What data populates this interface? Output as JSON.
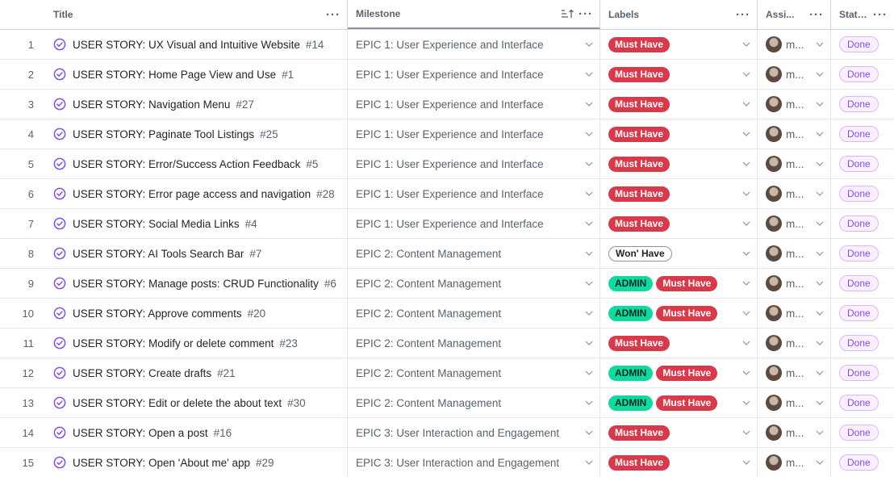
{
  "columns": {
    "title": "Title",
    "milestone": "Milestone",
    "labels": "Labels",
    "assignees": "Assi...",
    "status": "Status"
  },
  "colors": {
    "must_have": "#d73a4a",
    "admin": "#10d9a0",
    "status_done": "#8250df",
    "issue_icon": "#8250df"
  },
  "rows": [
    {
      "num": "1",
      "title": "USER STORY: UX Visual and Intuitive Website",
      "issue": "#14",
      "milestone": "EPIC 1: User Experience and Interface",
      "labels": [
        "Must Have"
      ],
      "assignee": "m...",
      "status": "Done"
    },
    {
      "num": "2",
      "title": "USER STORY: Home Page View and Use",
      "issue": "#1",
      "milestone": "EPIC 1: User Experience and Interface",
      "labels": [
        "Must Have"
      ],
      "assignee": "m...",
      "status": "Done"
    },
    {
      "num": "3",
      "title": "USER STORY: Navigation Menu",
      "issue": "#27",
      "milestone": "EPIC 1: User Experience and Interface",
      "labels": [
        "Must Have"
      ],
      "assignee": "m...",
      "status": "Done"
    },
    {
      "num": "4",
      "title": "USER STORY: Paginate Tool Listings",
      "issue": "#25",
      "milestone": "EPIC 1: User Experience and Interface",
      "labels": [
        "Must Have"
      ],
      "assignee": "m...",
      "status": "Done"
    },
    {
      "num": "5",
      "title": "USER STORY: Error/Success Action Feedback",
      "issue": "#5",
      "milestone": "EPIC 1: User Experience and Interface",
      "labels": [
        "Must Have"
      ],
      "assignee": "m...",
      "status": "Done"
    },
    {
      "num": "6",
      "title": "USER STORY: Error page access and navigation",
      "issue": "#28",
      "milestone": "EPIC 1: User Experience and Interface",
      "labels": [
        "Must Have"
      ],
      "assignee": "m...",
      "status": "Done"
    },
    {
      "num": "7",
      "title": "USER STORY: Social Media Links",
      "issue": "#4",
      "milestone": "EPIC 1: User Experience and Interface",
      "labels": [
        "Must Have"
      ],
      "assignee": "m...",
      "status": "Done"
    },
    {
      "num": "8",
      "title": "USER STORY: AI Tools Search Bar",
      "issue": "#7",
      "milestone": "EPIC 2: Content Management",
      "labels": [
        "Won' Have"
      ],
      "assignee": "m...",
      "status": "Done"
    },
    {
      "num": "9",
      "title": "USER STORY: Manage posts: CRUD Functionality",
      "issue": "#6",
      "milestone": "EPIC 2: Content Management",
      "labels": [
        "ADMIN",
        "Must Have"
      ],
      "assignee": "m...",
      "status": "Done"
    },
    {
      "num": "10",
      "title": "USER STORY: Approve comments",
      "issue": "#20",
      "milestone": "EPIC 2: Content Management",
      "labels": [
        "ADMIN",
        "Must Have"
      ],
      "assignee": "m...",
      "status": "Done"
    },
    {
      "num": "11",
      "title": "USER STORY: Modify or delete comment",
      "issue": "#23",
      "milestone": "EPIC 2: Content Management",
      "labels": [
        "Must Have"
      ],
      "assignee": "m...",
      "status": "Done"
    },
    {
      "num": "12",
      "title": "USER STORY: Create drafts",
      "issue": "#21",
      "milestone": "EPIC 2: Content Management",
      "labels": [
        "ADMIN",
        "Must Have"
      ],
      "assignee": "m...",
      "status": "Done"
    },
    {
      "num": "13",
      "title": "USER STORY: Edit or delete the about text",
      "issue": "#30",
      "milestone": "EPIC 2: Content Management",
      "labels": [
        "ADMIN",
        "Must Have"
      ],
      "assignee": "m...",
      "status": "Done"
    },
    {
      "num": "14",
      "title": "USER STORY: Open a post",
      "issue": "#16",
      "milestone": "EPIC 3: User Interaction and Engagement",
      "labels": [
        "Must Have"
      ],
      "assignee": "m...",
      "status": "Done"
    },
    {
      "num": "15",
      "title": "USER STORY: Open 'About me' app",
      "issue": "#29",
      "milestone": "EPIC 3: User Interaction and Engagement",
      "labels": [
        "Must Have"
      ],
      "assignee": "m...",
      "status": "Done"
    }
  ]
}
